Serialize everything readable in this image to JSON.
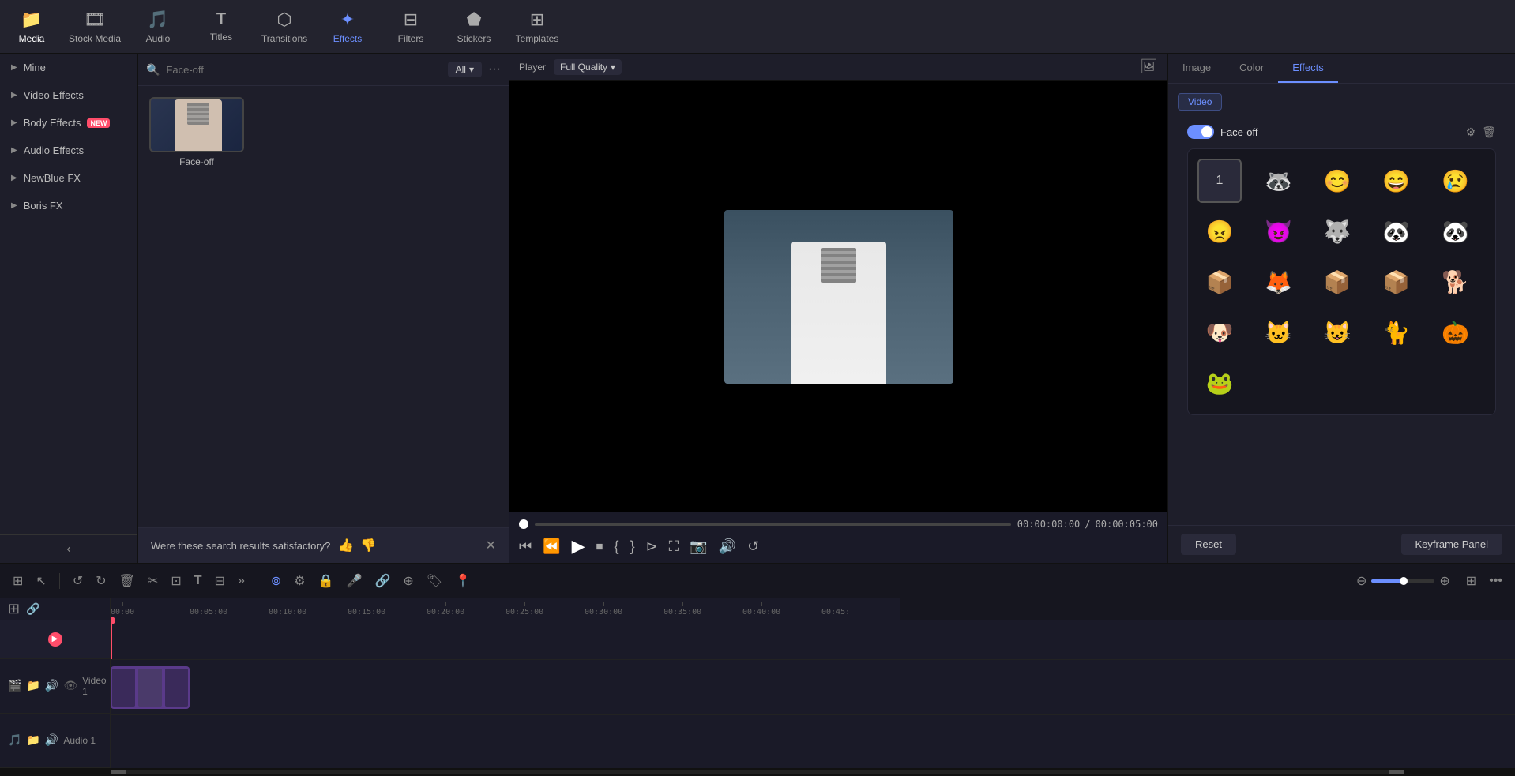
{
  "toolbar": {
    "items": [
      {
        "id": "media",
        "icon": "📁",
        "label": "Media"
      },
      {
        "id": "stock-media",
        "icon": "🎬",
        "label": "Stock Media"
      },
      {
        "id": "audio",
        "icon": "🎵",
        "label": "Audio"
      },
      {
        "id": "titles",
        "icon": "T",
        "label": "Titles"
      },
      {
        "id": "transitions",
        "icon": "⬡",
        "label": "Transitions"
      },
      {
        "id": "effects",
        "icon": "✦",
        "label": "Effects",
        "active": true
      },
      {
        "id": "filters",
        "icon": "🔲",
        "label": "Filters"
      },
      {
        "id": "stickers",
        "icon": "⬟",
        "label": "Stickers"
      },
      {
        "id": "templates",
        "icon": "⊞",
        "label": "Templates"
      }
    ]
  },
  "left_panel": {
    "items": [
      {
        "id": "mine",
        "label": "Mine"
      },
      {
        "id": "video-effects",
        "label": "Video Effects"
      },
      {
        "id": "body-effects",
        "label": "Body Effects",
        "badge": "NEW"
      },
      {
        "id": "audio-effects",
        "label": "Audio Effects"
      },
      {
        "id": "newblue-fx",
        "label": "NewBlue FX"
      },
      {
        "id": "boris-fx",
        "label": "Boris FX"
      }
    ]
  },
  "effects_panel": {
    "search_placeholder": "Face-off",
    "filter_label": "All",
    "effects": [
      {
        "id": "face-off",
        "label": "Face-off"
      }
    ],
    "feedback": {
      "question": "Were these search results satisfactory?"
    }
  },
  "player": {
    "label": "Player",
    "quality": "Full Quality",
    "current_time": "00:00:00:00",
    "total_time": "00:00:05:00"
  },
  "right_panel": {
    "tabs": [
      "Image",
      "Color",
      "Effects"
    ],
    "active_tab": "Effects",
    "section_label": "Video",
    "effect_name": "Face-off",
    "emojis": [
      {
        "id": "number",
        "display": "1",
        "type": "number",
        "selected": true
      },
      {
        "id": "raccoon",
        "display": "🦝",
        "selected": false
      },
      {
        "id": "smile",
        "display": "😊",
        "selected": false
      },
      {
        "id": "laugh",
        "display": "😄",
        "selected": false
      },
      {
        "id": "cry",
        "display": "😢",
        "selected": false
      },
      {
        "id": "angry",
        "display": "😠",
        "selected": false
      },
      {
        "id": "cat-devil",
        "display": "😈",
        "selected": false
      },
      {
        "id": "wolf",
        "display": "🐺",
        "selected": false
      },
      {
        "id": "panda",
        "display": "🐼",
        "selected": false
      },
      {
        "id": "panda2",
        "display": "🐼",
        "selected": false
      },
      {
        "id": "box1",
        "display": "📦",
        "selected": false
      },
      {
        "id": "fox",
        "display": "🦊",
        "selected": false
      },
      {
        "id": "box2",
        "display": "📦",
        "selected": false
      },
      {
        "id": "box3",
        "display": "📦",
        "selected": false
      },
      {
        "id": "husky",
        "display": "🐕",
        "selected": false
      },
      {
        "id": "dog",
        "display": "🐶",
        "selected": false
      },
      {
        "id": "cat-white",
        "display": "🐱",
        "selected": false
      },
      {
        "id": "cat-bw",
        "display": "😺",
        "selected": false
      },
      {
        "id": "cat2",
        "display": "🐈",
        "selected": false
      },
      {
        "id": "pumpkin",
        "display": "🎃",
        "selected": false
      },
      {
        "id": "frog",
        "display": "🐸",
        "selected": false
      }
    ],
    "reset_label": "Reset",
    "keyframe_label": "Keyframe Panel"
  },
  "timeline": {
    "tools": [
      {
        "id": "grid",
        "icon": "⊞",
        "label": "Grid"
      },
      {
        "id": "select",
        "icon": "↖",
        "label": "Select"
      },
      {
        "id": "undo",
        "icon": "↺",
        "label": "Undo"
      },
      {
        "id": "redo",
        "icon": "↻",
        "label": "Redo"
      },
      {
        "id": "delete",
        "icon": "🗑",
        "label": "Delete"
      },
      {
        "id": "cut",
        "icon": "✂",
        "label": "Cut"
      },
      {
        "id": "crop",
        "icon": "⊡",
        "label": "Crop"
      },
      {
        "id": "text",
        "icon": "T",
        "label": "Text"
      },
      {
        "id": "split",
        "icon": "⊟",
        "label": "Split"
      },
      {
        "id": "more",
        "icon": "»",
        "label": "More"
      }
    ],
    "tracks": [
      {
        "id": "video-1",
        "label": "Video 1",
        "icons": [
          "🎬",
          "📁",
          "🔊",
          "👁"
        ]
      },
      {
        "id": "audio-1",
        "label": "Audio 1",
        "icons": [
          "🎵",
          "📁",
          "🔊"
        ]
      }
    ],
    "time_marks": [
      "00:00",
      "00:05:00",
      "00:10:00",
      "00:15:00",
      "00:20:00",
      "00:25:00",
      "00:30:00",
      "00:35:00",
      "00:40:00",
      "00:45:"
    ],
    "zoom_level": 50
  }
}
